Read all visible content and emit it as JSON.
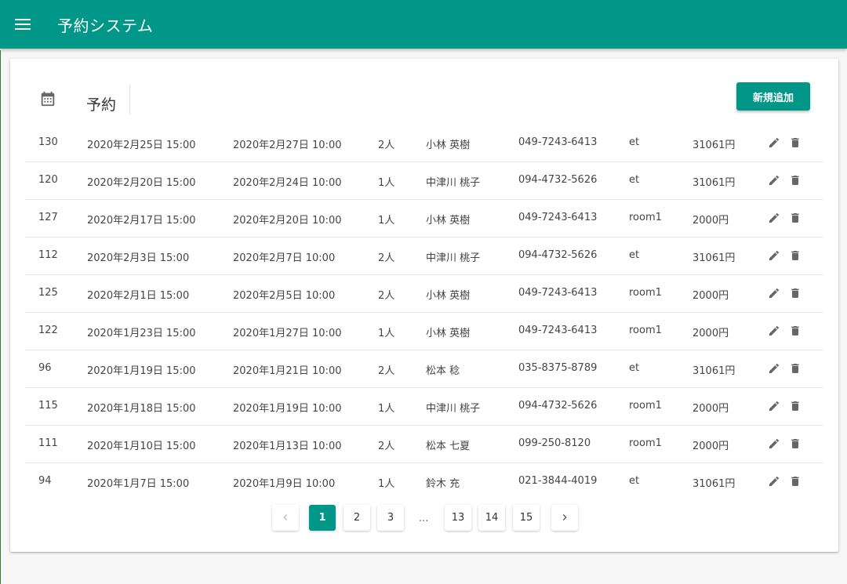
{
  "appbar": {
    "title": "予約システム",
    "menu_icon": "hamburger-menu-icon"
  },
  "card": {
    "icon": "calendar-icon",
    "title": "予約",
    "add_button": "新規追加"
  },
  "colors": {
    "primary": "#009688",
    "text": "#444444",
    "divider": "#e4e4e4"
  },
  "reservations": [
    {
      "id": "130",
      "checkin": "2020年2月25日 15:00",
      "checkout": "2020年2月27日 10:00",
      "guests": "2人",
      "name": "小林 英樹",
      "phone": "049-7243-6413",
      "room": "et",
      "price": "31061円"
    },
    {
      "id": "120",
      "checkin": "2020年2月20日 15:00",
      "checkout": "2020年2月24日 10:00",
      "guests": "1人",
      "name": "中津川 桃子",
      "phone": "094-4732-5626",
      "room": "et",
      "price": "31061円"
    },
    {
      "id": "127",
      "checkin": "2020年2月17日 15:00",
      "checkout": "2020年2月20日 10:00",
      "guests": "1人",
      "name": "小林 英樹",
      "phone": "049-7243-6413",
      "room": "room1",
      "price": "2000円"
    },
    {
      "id": "112",
      "checkin": "2020年2月3日 15:00",
      "checkout": "2020年2月7日 10:00",
      "guests": "2人",
      "name": "中津川 桃子",
      "phone": "094-4732-5626",
      "room": "et",
      "price": "31061円"
    },
    {
      "id": "125",
      "checkin": "2020年2月1日 15:00",
      "checkout": "2020年2月5日 10:00",
      "guests": "2人",
      "name": "小林 英樹",
      "phone": "049-7243-6413",
      "room": "room1",
      "price": "2000円"
    },
    {
      "id": "122",
      "checkin": "2020年1月23日 15:00",
      "checkout": "2020年1月27日 10:00",
      "guests": "1人",
      "name": "小林 英樹",
      "phone": "049-7243-6413",
      "room": "room1",
      "price": "2000円"
    },
    {
      "id": "96",
      "checkin": "2020年1月19日 15:00",
      "checkout": "2020年1月21日 10:00",
      "guests": "2人",
      "name": "松本 稔",
      "phone": "035-8375-8789",
      "room": "et",
      "price": "31061円"
    },
    {
      "id": "115",
      "checkin": "2020年1月18日 15:00",
      "checkout": "2020年1月19日 10:00",
      "guests": "1人",
      "name": "中津川 桃子",
      "phone": "094-4732-5626",
      "room": "room1",
      "price": "2000円"
    },
    {
      "id": "111",
      "checkin": "2020年1月10日 15:00",
      "checkout": "2020年1月13日 10:00",
      "guests": "2人",
      "name": "松本 七夏",
      "phone": "099-250-8120",
      "room": "room1",
      "price": "2000円"
    },
    {
      "id": "94",
      "checkin": "2020年1月7日 15:00",
      "checkout": "2020年1月9日 10:00",
      "guests": "1人",
      "name": "鈴木 充",
      "phone": "021-3844-4019",
      "room": "et",
      "price": "31061円"
    }
  ],
  "row_actions": {
    "edit_icon": "pencil-icon",
    "delete_icon": "trash-icon"
  },
  "pagination": {
    "prev_icon": "chevron-left-icon",
    "next_icon": "chevron-right-icon",
    "pages": [
      "1",
      "2",
      "3",
      "13",
      "14",
      "15"
    ],
    "ellipsis": "...",
    "current": "1"
  }
}
